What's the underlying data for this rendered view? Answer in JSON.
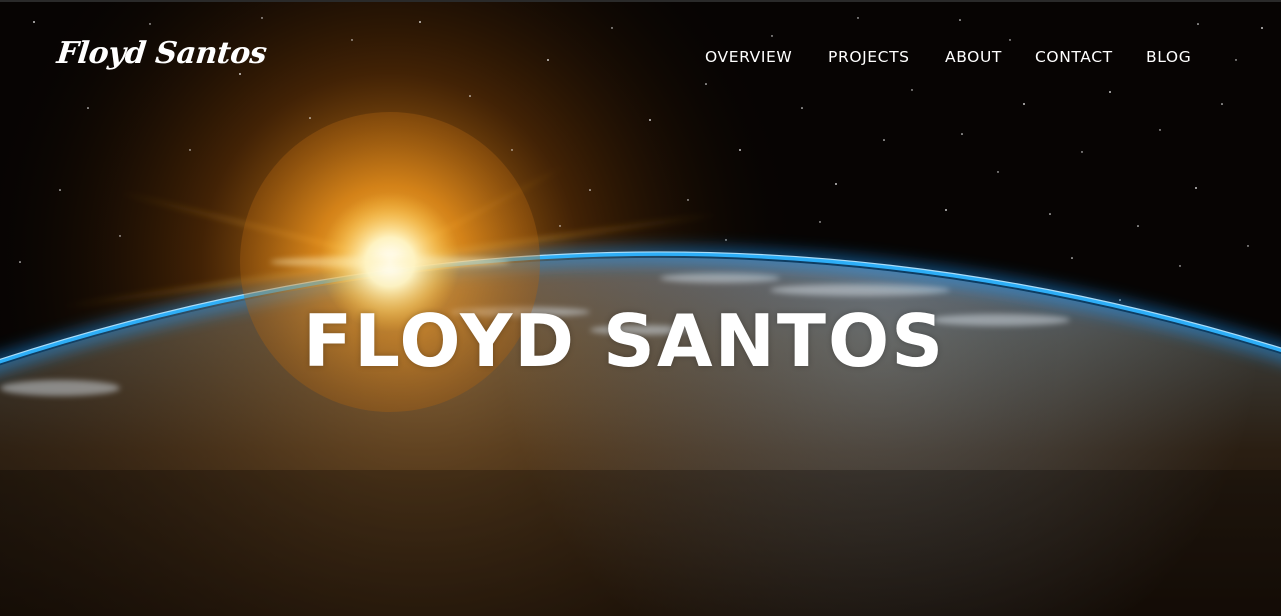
{
  "brand": {
    "name": "Floyd Santos"
  },
  "nav": {
    "items": [
      {
        "label": "OVERVIEW"
      },
      {
        "label": "PROJECTS"
      },
      {
        "label": "ABOUT"
      },
      {
        "label": "CONTACT"
      },
      {
        "label": "BLOG"
      }
    ]
  },
  "hero": {
    "title": "FLOYD SANTOS",
    "background": "earth-sunrise-from-space-image"
  },
  "colors": {
    "text": "#ffffff",
    "space": "#050302",
    "atmosphere": "#1ea7ff",
    "sun": "#ffb52e"
  }
}
